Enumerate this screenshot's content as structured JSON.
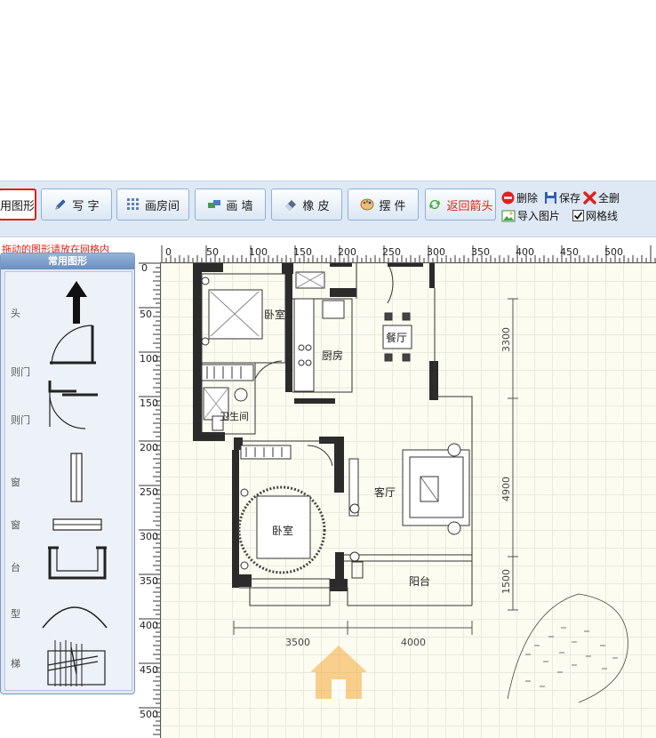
{
  "toolbar": {
    "common_shapes": "用图形",
    "write": "写 字",
    "draw_room": "画房间",
    "draw_wall": "画 墙",
    "eraser": "橡 皮",
    "furniture": "摆 件",
    "back_arrow": "返回箭头",
    "delete": "删除",
    "save": "保存",
    "select_all": "全删",
    "import_image": "导入图片",
    "grid": "网格线",
    "grid_checked": true
  },
  "hint": "拖动的图形请放在网格内",
  "palette": {
    "title": "常用图形",
    "labels": [
      "头",
      "则门",
      "则门",
      "窗",
      "窗",
      "台",
      "型",
      "梯"
    ]
  },
  "ruler": {
    "top": [
      "0",
      "50",
      "100",
      "150",
      "200",
      "250",
      "300",
      "350",
      "400",
      "450",
      "500"
    ],
    "left": [
      "0",
      "50",
      "100",
      "150",
      "200",
      "250",
      "300",
      "350",
      "400",
      "450",
      "500"
    ]
  },
  "floorplan": {
    "rooms": {
      "bedroom1": "卧室",
      "kitchen": "厨房",
      "dining": "餐厅",
      "bathroom": "卫生间",
      "living": "客厅",
      "bedroom2": "卧室",
      "balcony": "阳台"
    },
    "dimensions": {
      "d1": "3300",
      "d2": "4900",
      "d3": "1500",
      "w1": "3500",
      "w2": "4000"
    }
  },
  "colors": {
    "toolbar_bg": "#dfe9f5",
    "accent_red": "#d21",
    "wall": "#2b2b2b",
    "canvas_bg": "#fdfcf0",
    "watermark": "#f2a030"
  },
  "icons": [
    "pencil-icon",
    "grid-room-icon",
    "wall-icon",
    "eraser-icon",
    "palette-icon",
    "refresh-icon",
    "delete-icon",
    "save-icon",
    "close-x-icon",
    "image-icon",
    "checkbox-icon"
  ]
}
